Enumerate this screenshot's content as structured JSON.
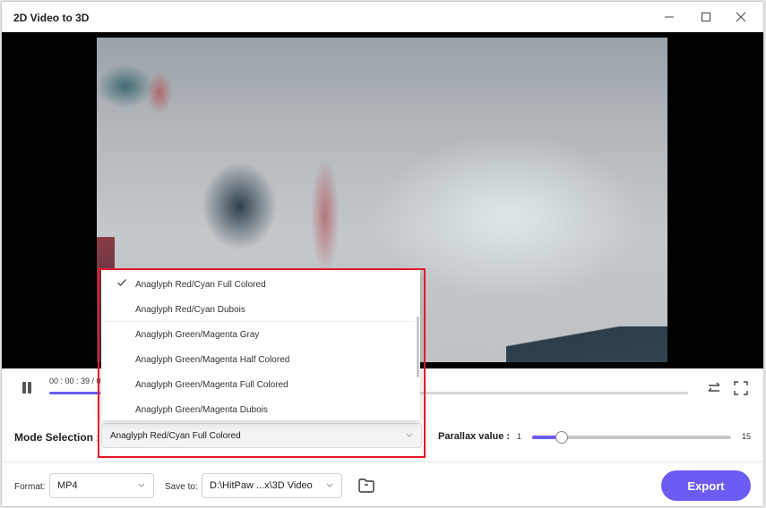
{
  "window": {
    "title": "2D Video to 3D",
    "controls": {
      "minimize": "minimize-icon",
      "maximize": "maximize-icon",
      "close": "close-icon"
    }
  },
  "player": {
    "time_display": "00 : 00 : 39 / 0",
    "progress_fraction": 0.08,
    "icons": {
      "pause": "pause-icon",
      "swap": "swap-arrows-icon",
      "fullscreen": "fullscreen-icon"
    }
  },
  "mode": {
    "label": "Mode Selection :",
    "selected": "Anaglyph Red/Cyan Full Colored",
    "options": [
      {
        "label": "Anaglyph Red/Cyan Full Colored",
        "checked": true
      },
      {
        "label": "Anaglyph Red/Cyan Dubois",
        "checked": false
      },
      {
        "label": "Anaglyph Green/Magenta Gray",
        "checked": false
      },
      {
        "label": "Anaglyph Green/Magenta Half Colored",
        "checked": false
      },
      {
        "label": "Anaglyph Green/Magenta Full Colored",
        "checked": false
      },
      {
        "label": "Anaglyph Green/Magenta Dubois",
        "checked": false
      }
    ]
  },
  "parallax": {
    "label": "Parallax value :",
    "min": "1",
    "max": "15",
    "value": 3
  },
  "footer": {
    "format_label": "Format:",
    "format_value": "MP4",
    "save_label": "Save to:",
    "save_value": "D:\\HitPaw ...x\\3D Video",
    "folder_icon": "folder-icon",
    "export_label": "Export"
  },
  "colors": {
    "accent": "#6c5cf4",
    "highlight_border": "#e21b2b"
  }
}
